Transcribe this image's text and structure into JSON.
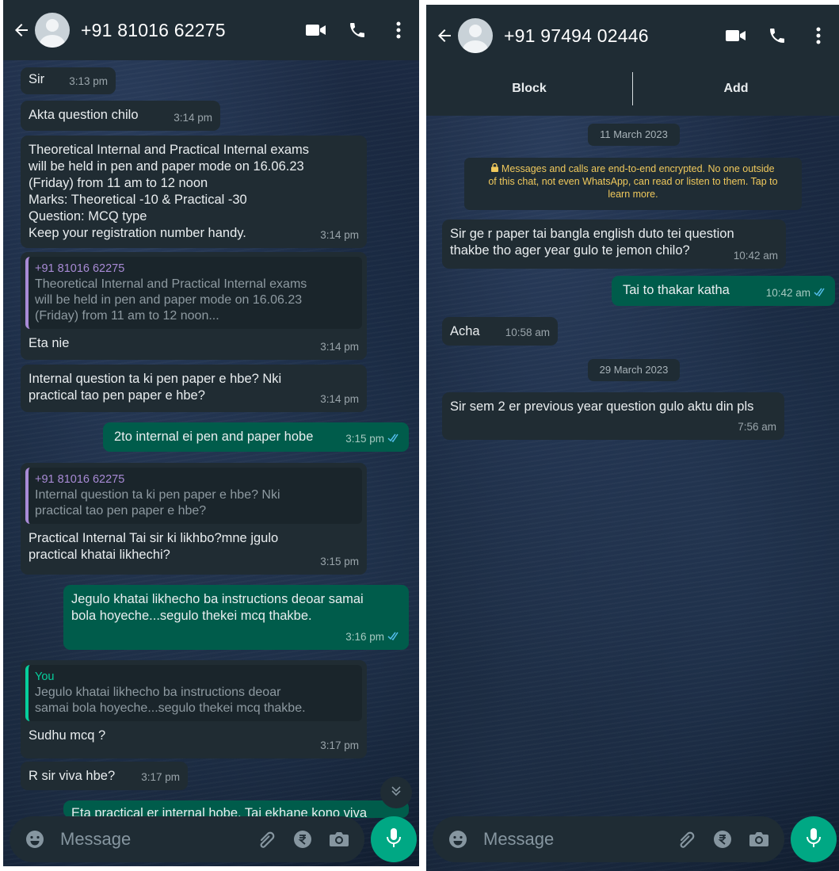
{
  "left": {
    "contact": "+91 81016 62275",
    "messages": [
      {
        "text": "Sir",
        "time": "3:13 pm"
      },
      {
        "text": "Akta question chilo",
        "time": "3:14 pm"
      },
      {
        "text": "Theoretical Internal and Practical Internal exams\nwill be held in pen and paper mode on 16.06.23\n(Friday) from 11 am to 12 noon\nMarks: Theoretical -10 & Practical -30\nQuestion: MCQ type\nKeep your registration number handy.",
        "time": "3:14 pm"
      },
      {
        "quote_author": "+91 81016 62275",
        "quote_text": "Theoretical Internal and Practical Internal exams\nwill be held in pen and paper mode on 16.06.23\n(Friday) from 11 am to 12 noon...",
        "text": "Eta nie",
        "time": "3:14 pm"
      },
      {
        "text": "Internal question ta ki pen paper e hbe? Nki\npractical tao pen paper e hbe?",
        "time": "3:14 pm"
      },
      {
        "text": "2to internal ei pen and paper hobe",
        "time": "3:15 pm"
      },
      {
        "quote_author": "+91 81016 62275",
        "quote_text": "Internal question ta ki pen paper e hbe? Nki\npractical tao pen paper e hbe?",
        "text": "Practical Internal Tai sir ki likhbo?mne jgulo\npractical khatai likhechi?",
        "time": "3:15 pm"
      },
      {
        "text": "Jegulo khatai likhecho ba instructions deoar samai\nbola hoyeche...segulo thekei mcq thakbe.",
        "time": "3:16 pm"
      },
      {
        "quote_author": "You",
        "quote_text": "Jegulo khatai likhecho ba instructions deoar\nsamai bola hoyeche...segulo thekei mcq thakbe.",
        "text": "Sudhu mcq ?",
        "time": "3:17 pm"
      },
      {
        "text": "R sir viva hbe?",
        "time": "3:17 pm"
      },
      {
        "text": "Eta practical er internal hobe. Tai ekhane kono viva"
      }
    ],
    "composer_placeholder": "Message"
  },
  "right": {
    "contact": "+91 97494 02446",
    "block_label": "Block",
    "add_label": "Add",
    "date1": "11 March 2023",
    "e2e_note": "Messages and calls are end-to-end encrypted. No one outside\nof this chat, not even WhatsApp, can read or listen to them. Tap to\nlearn more.",
    "messages": [
      {
        "text": "Sir ge r paper tai bangla english duto tei question\nthakbe tho ager year gulo te jemon chilo?",
        "time": "10:42 am"
      },
      {
        "text": "Tai to thakar katha",
        "time": "10:42 am"
      },
      {
        "text": "Acha",
        "time": "10:58 am"
      },
      {
        "text": "Sir sem 2 er previous year question gulo aktu din pls",
        "time": "7:56 am"
      }
    ],
    "date2": "29 March 2023",
    "composer_placeholder": "Message"
  },
  "icons": {
    "back": "back-arrow-icon",
    "avatar": "default-avatar-icon",
    "video": "video-call-icon",
    "call": "phone-call-icon",
    "menu": "more-vert-icon",
    "emoji": "emoji-icon",
    "attach": "paperclip-icon",
    "payment": "rupee-icon",
    "camera": "camera-icon",
    "mic": "microphone-icon",
    "lock": "lock-icon",
    "read_receipt": "double-check-icon",
    "scroll": "chevron-double-down-icon"
  },
  "colors": {
    "header": "#1f2c34",
    "incoming": "#202c33",
    "outgoing": "#005c4b",
    "accent": "#00a884",
    "read_ticks": "#53bdeb",
    "e2e_text": "#f0c95c",
    "quote_author": "#a98bd6"
  }
}
